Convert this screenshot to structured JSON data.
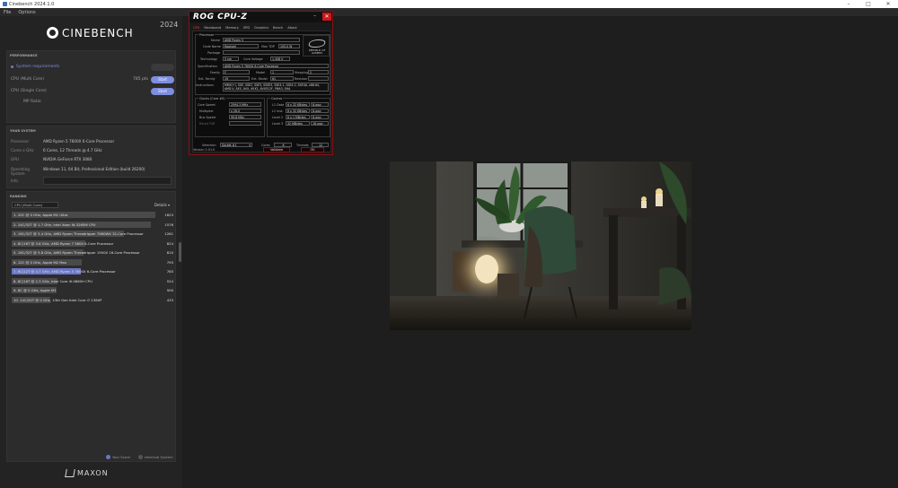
{
  "window": {
    "title": "Cinebench 2024.1.0",
    "menu": [
      "File",
      "Options"
    ]
  },
  "brand": {
    "name": "CINEBENCH",
    "year": "2024"
  },
  "performance": {
    "header": "PERFORMANCE",
    "rows": [
      {
        "label": "System requirements",
        "points": "",
        "action": ""
      },
      {
        "label": "CPU (Multi Core)",
        "points": "785 pts",
        "action": "Start"
      },
      {
        "label": "CPU (Single Core)",
        "points": "",
        "action": "Start"
      },
      {
        "label": "MP Ratio",
        "points": "",
        "action": ""
      }
    ]
  },
  "system": {
    "header": "YOUR SYSTEM",
    "rows": [
      {
        "key": "Processor",
        "value": "AMD Ryzen 5 7600X 6-Core Processor"
      },
      {
        "key": "Cores x GHz",
        "value": "6 Cores, 12 Threads @ 4.7 GHz"
      },
      {
        "key": "GPU",
        "value": "NVIDIA GeForce RTX 3080"
      },
      {
        "key": "Operating System",
        "value": "Windows 11, 64 Bit, Professional Edition (build 26200)"
      },
      {
        "key": "Info",
        "value": ""
      }
    ]
  },
  "ranking": {
    "header": "RANKING",
    "selector": "CPU (Multi Core)",
    "details_label": "Details",
    "rows": [
      {
        "label": "1. 20C @ 0 GHz, Apple M1 Ultra",
        "score": "1623",
        "fraction": 1.0,
        "highlight": false
      },
      {
        "label": "2. 24C/32T @ 1.7 GHz, Intel Xeon W-3265M CPU",
        "score": "1576",
        "fraction": 0.97,
        "highlight": false
      },
      {
        "label": "3. 16C/32T @ 3.4 GHz, AMD Ryzen Threadripper 7980WX 32-Core Processor",
        "score": "1261",
        "fraction": 0.78,
        "highlight": false
      },
      {
        "label": "4. 8C/16T @ 3.8 GHz, AMD Ryzen 7 5800 8-Core Processor",
        "score": "824",
        "fraction": 0.51,
        "highlight": false
      },
      {
        "label": "5. 16C/32T @ 3.8 GHz, AMD Ryzen Threadripper 1950X 16-Core Processor",
        "score": "810",
        "fraction": 0.5,
        "highlight": false
      },
      {
        "label": "6. 12C @ 0 GHz, Apple M2 Max",
        "score": "793",
        "fraction": 0.49,
        "highlight": false
      },
      {
        "label": "7. 6C/12T @ 4.7 GHz, AMD Ryzen 5 7600X 6-Core Processor",
        "score": "785",
        "fraction": 0.48,
        "highlight": true
      },
      {
        "label": "8. 8C/16T @ 2.3 GHz, Intel Core i9-9880H CPU",
        "score": "524",
        "fraction": 0.32,
        "highlight": false
      },
      {
        "label": "9. 8C @ 0 GHz, Apple M1",
        "score": "500",
        "fraction": 0.31,
        "highlight": false
      },
      {
        "label": "10. 14C/20T @ 0 GHz, 13th Gen Intel Core i7-1360P",
        "score": "433",
        "fraction": 0.27,
        "highlight": false
      }
    ],
    "legend": [
      "Your Score",
      "Identical System"
    ]
  },
  "footer": {
    "maxon": "MAXON"
  },
  "cpuz": {
    "title": "ROG CPU-Z",
    "tabs": [
      "CPU",
      "Mainboard",
      "Memory",
      "SPD",
      "Graphics",
      "Bench",
      "About"
    ],
    "groups": {
      "processor": "Processor",
      "clocks": "Clocks (Core #0)",
      "caches": "Caches"
    },
    "labels": {
      "name": "Name",
      "code_name": "Code Name",
      "max_tdp": "Max TDP",
      "package": "Package",
      "technology": "Technology",
      "core_voltage": "Core Voltage",
      "specification": "Specification",
      "family": "Family",
      "model": "Model",
      "stepping": "Stepping",
      "ext_family": "Ext. Family",
      "ext_model": "Ext. Model",
      "revision": "Revision",
      "instructions": "Instructions",
      "core_speed": "Core Speed",
      "multiplier": "Multiplier",
      "bus_speed": "Bus Speed",
      "rated_fsb": "Rated FSB",
      "l1_data": "L1 Data",
      "l1_inst": "L1 Inst.",
      "level2": "Level 2",
      "level3": "Level 3",
      "selection": "Selection",
      "cores": "Cores",
      "threads": "Threads"
    },
    "values": {
      "name": "AMD Ryzen 5",
      "code_name": "Raphael",
      "max_tdp": "105.0 W",
      "package": "",
      "technology": "5 nm",
      "core_voltage": "1.308 V",
      "specification": "AMD Ryzen 5 7600X 6-Core Processor",
      "family": "F",
      "model": "1",
      "stepping": "2",
      "ext_family": "19",
      "ext_model": "61",
      "revision": "",
      "instructions": "MMX(+), SSE, SSE2, SSE3, SSSE3, SSE4.1, SSE4.2, SSE4A, x86-64, AMD-V, AES, AVX, AVX2, AVX512F, FMA3, SHA",
      "core_speed": "2594.3 MHz",
      "multiplier": "x 26.0",
      "bus_speed": "99.8 MHz",
      "rated_fsb": "",
      "l1_data": "6 x 32 KBytes",
      "l1_data_way": "8-way",
      "l1_inst": "6 x 32 KBytes",
      "l1_inst_way": "8-way",
      "level2": "6 x 1 MBytes",
      "level2_way": "8-way",
      "level3": "32 MBytes",
      "level3_way": "16-way",
      "selection": "Socket #1",
      "cores": "6",
      "threads": "12"
    },
    "buttons": {
      "validate": "Validate",
      "ok": "OK"
    },
    "version": "Version 2.01.0",
    "logo_text": "REPUBLIC OF GAMERS"
  }
}
